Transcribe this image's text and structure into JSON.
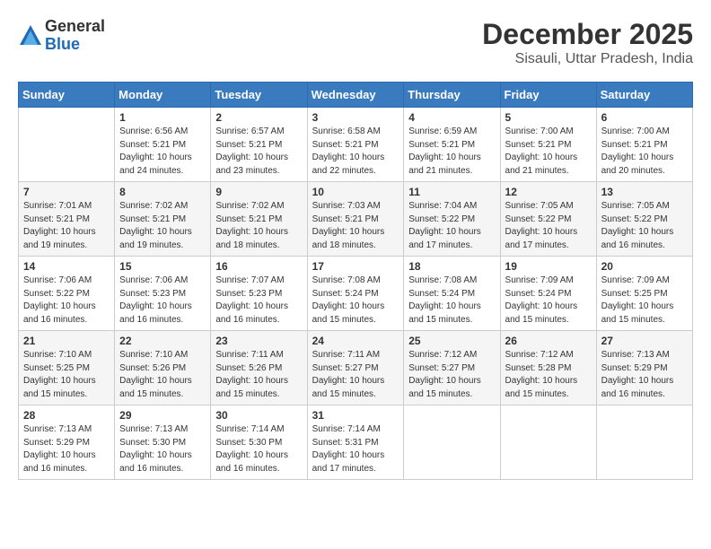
{
  "logo": {
    "general": "General",
    "blue": "Blue"
  },
  "title": "December 2025",
  "location": "Sisauli, Uttar Pradesh, India",
  "days_of_week": [
    "Sunday",
    "Monday",
    "Tuesday",
    "Wednesday",
    "Thursday",
    "Friday",
    "Saturday"
  ],
  "weeks": [
    [
      {
        "day": "",
        "info": ""
      },
      {
        "day": "1",
        "info": "Sunrise: 6:56 AM\nSunset: 5:21 PM\nDaylight: 10 hours\nand 24 minutes."
      },
      {
        "day": "2",
        "info": "Sunrise: 6:57 AM\nSunset: 5:21 PM\nDaylight: 10 hours\nand 23 minutes."
      },
      {
        "day": "3",
        "info": "Sunrise: 6:58 AM\nSunset: 5:21 PM\nDaylight: 10 hours\nand 22 minutes."
      },
      {
        "day": "4",
        "info": "Sunrise: 6:59 AM\nSunset: 5:21 PM\nDaylight: 10 hours\nand 21 minutes."
      },
      {
        "day": "5",
        "info": "Sunrise: 7:00 AM\nSunset: 5:21 PM\nDaylight: 10 hours\nand 21 minutes."
      },
      {
        "day": "6",
        "info": "Sunrise: 7:00 AM\nSunset: 5:21 PM\nDaylight: 10 hours\nand 20 minutes."
      }
    ],
    [
      {
        "day": "7",
        "info": "Sunrise: 7:01 AM\nSunset: 5:21 PM\nDaylight: 10 hours\nand 19 minutes."
      },
      {
        "day": "8",
        "info": "Sunrise: 7:02 AM\nSunset: 5:21 PM\nDaylight: 10 hours\nand 19 minutes."
      },
      {
        "day": "9",
        "info": "Sunrise: 7:02 AM\nSunset: 5:21 PM\nDaylight: 10 hours\nand 18 minutes."
      },
      {
        "day": "10",
        "info": "Sunrise: 7:03 AM\nSunset: 5:21 PM\nDaylight: 10 hours\nand 18 minutes."
      },
      {
        "day": "11",
        "info": "Sunrise: 7:04 AM\nSunset: 5:22 PM\nDaylight: 10 hours\nand 17 minutes."
      },
      {
        "day": "12",
        "info": "Sunrise: 7:05 AM\nSunset: 5:22 PM\nDaylight: 10 hours\nand 17 minutes."
      },
      {
        "day": "13",
        "info": "Sunrise: 7:05 AM\nSunset: 5:22 PM\nDaylight: 10 hours\nand 16 minutes."
      }
    ],
    [
      {
        "day": "14",
        "info": "Sunrise: 7:06 AM\nSunset: 5:22 PM\nDaylight: 10 hours\nand 16 minutes."
      },
      {
        "day": "15",
        "info": "Sunrise: 7:06 AM\nSunset: 5:23 PM\nDaylight: 10 hours\nand 16 minutes."
      },
      {
        "day": "16",
        "info": "Sunrise: 7:07 AM\nSunset: 5:23 PM\nDaylight: 10 hours\nand 16 minutes."
      },
      {
        "day": "17",
        "info": "Sunrise: 7:08 AM\nSunset: 5:24 PM\nDaylight: 10 hours\nand 15 minutes."
      },
      {
        "day": "18",
        "info": "Sunrise: 7:08 AM\nSunset: 5:24 PM\nDaylight: 10 hours\nand 15 minutes."
      },
      {
        "day": "19",
        "info": "Sunrise: 7:09 AM\nSunset: 5:24 PM\nDaylight: 10 hours\nand 15 minutes."
      },
      {
        "day": "20",
        "info": "Sunrise: 7:09 AM\nSunset: 5:25 PM\nDaylight: 10 hours\nand 15 minutes."
      }
    ],
    [
      {
        "day": "21",
        "info": "Sunrise: 7:10 AM\nSunset: 5:25 PM\nDaylight: 10 hours\nand 15 minutes."
      },
      {
        "day": "22",
        "info": "Sunrise: 7:10 AM\nSunset: 5:26 PM\nDaylight: 10 hours\nand 15 minutes."
      },
      {
        "day": "23",
        "info": "Sunrise: 7:11 AM\nSunset: 5:26 PM\nDaylight: 10 hours\nand 15 minutes."
      },
      {
        "day": "24",
        "info": "Sunrise: 7:11 AM\nSunset: 5:27 PM\nDaylight: 10 hours\nand 15 minutes."
      },
      {
        "day": "25",
        "info": "Sunrise: 7:12 AM\nSunset: 5:27 PM\nDaylight: 10 hours\nand 15 minutes."
      },
      {
        "day": "26",
        "info": "Sunrise: 7:12 AM\nSunset: 5:28 PM\nDaylight: 10 hours\nand 15 minutes."
      },
      {
        "day": "27",
        "info": "Sunrise: 7:13 AM\nSunset: 5:29 PM\nDaylight: 10 hours\nand 16 minutes."
      }
    ],
    [
      {
        "day": "28",
        "info": "Sunrise: 7:13 AM\nSunset: 5:29 PM\nDaylight: 10 hours\nand 16 minutes."
      },
      {
        "day": "29",
        "info": "Sunrise: 7:13 AM\nSunset: 5:30 PM\nDaylight: 10 hours\nand 16 minutes."
      },
      {
        "day": "30",
        "info": "Sunrise: 7:14 AM\nSunset: 5:30 PM\nDaylight: 10 hours\nand 16 minutes."
      },
      {
        "day": "31",
        "info": "Sunrise: 7:14 AM\nSunset: 5:31 PM\nDaylight: 10 hours\nand 17 minutes."
      },
      {
        "day": "",
        "info": ""
      },
      {
        "day": "",
        "info": ""
      },
      {
        "day": "",
        "info": ""
      }
    ]
  ]
}
